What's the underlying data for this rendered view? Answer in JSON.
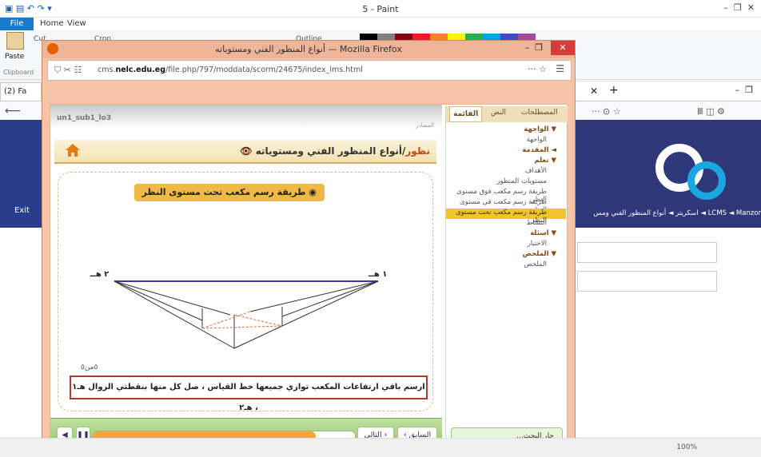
{
  "paint": {
    "title": "5 - Paint",
    "file_tab": "File",
    "home_tab": "Home",
    "view_tab": "View",
    "paste_label": "Paste",
    "cut_label": "Cut",
    "crop_label": "Crop",
    "outline_label": "Outline",
    "clipboard_label": "Clipboard",
    "zoom": "100%"
  },
  "bg_browser": {
    "tab_label": "(2) Fa",
    "left_banner_text": "Exit",
    "breadcrumb": "LCMS  ◄  Manzor  ◄  اسكريتر  ◄  أنواع المنظور الفني ومس"
  },
  "firefox": {
    "title": "أنواع المنظور الفني ومستوياته — Mozilla Firefox",
    "url_prefix": "cms.",
    "url_host": "nelc.edu.eg",
    "url_path": "/file.php/797/moddata/scorm/24675/index_lms.html",
    "url_menu": "··· ☆"
  },
  "course": {
    "code": "un1_sub1_lo3",
    "sub_small": "المصادر",
    "title_orange": "نظور",
    "title_dark": "/أنواع المنظور الفني ومستوياته",
    "subtitle": "طريقة رسم مكعب تحت مستوى النظر",
    "point_left": "٢ هــ",
    "point_right": "١ هــ",
    "instruction": "ارسم باقي ارتفاعات المكعب توازي جميعها خط القياس ، صل كل منها بنقطتي الزوال هـ١ ، هـ٢",
    "page_no": "٥من٥",
    "next_btn": "التالي ›",
    "prev_btn": "‹ السابق",
    "progress": 0.85
  },
  "menu": {
    "tabs": [
      "المصطلحات",
      "النص",
      "القائمة"
    ],
    "items": [
      {
        "label": "▼ الواجهة",
        "level": 1
      },
      {
        "label": "الواجهة",
        "level": 2
      },
      {
        "label": "◄ المقدمة",
        "level": 1
      },
      {
        "label": "▼ تعلم",
        "level": 1
      },
      {
        "label": "الأهداف",
        "level": 2
      },
      {
        "label": "مستويات المنظور",
        "level": 2
      },
      {
        "label": "طريقة رسم مكعب فوق مستوى النظر",
        "level": 2
      },
      {
        "label": "طريقة رسم مكعب في مستوى النظر",
        "level": 2
      },
      {
        "label": "طريقة رسم مكعب تحت مستوى النظر",
        "level": 2,
        "active": true
      },
      {
        "label": "النشاط",
        "level": 2
      },
      {
        "label": "▼ اسئلة",
        "level": 1
      },
      {
        "label": "الاختبار",
        "level": 2
      },
      {
        "label": "▼ الملخص",
        "level": 1
      },
      {
        "label": "الملخص",
        "level": 2
      }
    ],
    "search_placeholder": "جار البحث..."
  }
}
